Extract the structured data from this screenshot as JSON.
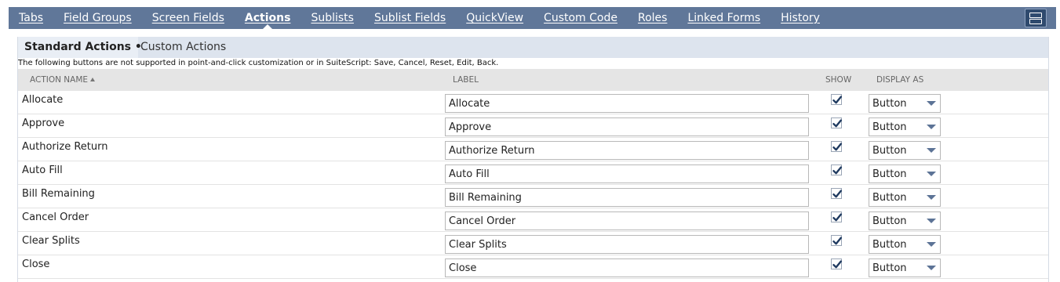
{
  "top_tabs": [
    {
      "label": "Tabs"
    },
    {
      "label": "Field Groups"
    },
    {
      "label": "Screen Fields"
    },
    {
      "label": "Actions"
    },
    {
      "label": "Sublists"
    },
    {
      "label": "Sublist Fields"
    },
    {
      "label": "QuickView"
    },
    {
      "label": "Custom Code"
    },
    {
      "label": "Roles"
    },
    {
      "label": "Linked Forms"
    },
    {
      "label": "History"
    }
  ],
  "active_top_tab": "Actions",
  "subtabs": {
    "standard_label": "Standard Actions",
    "standard_marker": "•",
    "custom_label": "Custom Actions"
  },
  "notice": "The following buttons are not supported in point-and-click customization or in SuiteScript: Save, Cancel, Reset, Edit, Back.",
  "table": {
    "headers": {
      "action_name": "ACTION NAME",
      "label": "LABEL",
      "show": "SHOW",
      "display_as": "DISPLAY AS"
    },
    "rows": [
      {
        "action_name": "Allocate",
        "label": "Allocate",
        "show": true,
        "display_as": "Button"
      },
      {
        "action_name": "Approve",
        "label": "Approve",
        "show": true,
        "display_as": "Button"
      },
      {
        "action_name": "Authorize Return",
        "label": "Authorize Return",
        "show": true,
        "display_as": "Button"
      },
      {
        "action_name": "Auto Fill",
        "label": "Auto Fill",
        "show": true,
        "display_as": "Button"
      },
      {
        "action_name": "Bill Remaining",
        "label": "Bill Remaining",
        "show": true,
        "display_as": "Button"
      },
      {
        "action_name": "Cancel Order",
        "label": "Cancel Order",
        "show": true,
        "display_as": "Button"
      },
      {
        "action_name": "Clear Splits",
        "label": "Clear Splits",
        "show": true,
        "display_as": "Button"
      },
      {
        "action_name": "Close",
        "label": "Close",
        "show": true,
        "display_as": "Button"
      }
    ]
  },
  "icons": {
    "layout_toggle": "layout-toggle-icon",
    "sort": "sort-ascending-icon",
    "check": "checkmark-icon",
    "dropdown": "chevron-down-icon"
  },
  "colors": {
    "top_bar": "#607799",
    "subtab_bar": "#dde4ee",
    "header_bg": "#e5e5e5",
    "checkmark": "#1f3a60",
    "dropdown_caret": "#5c7396"
  }
}
